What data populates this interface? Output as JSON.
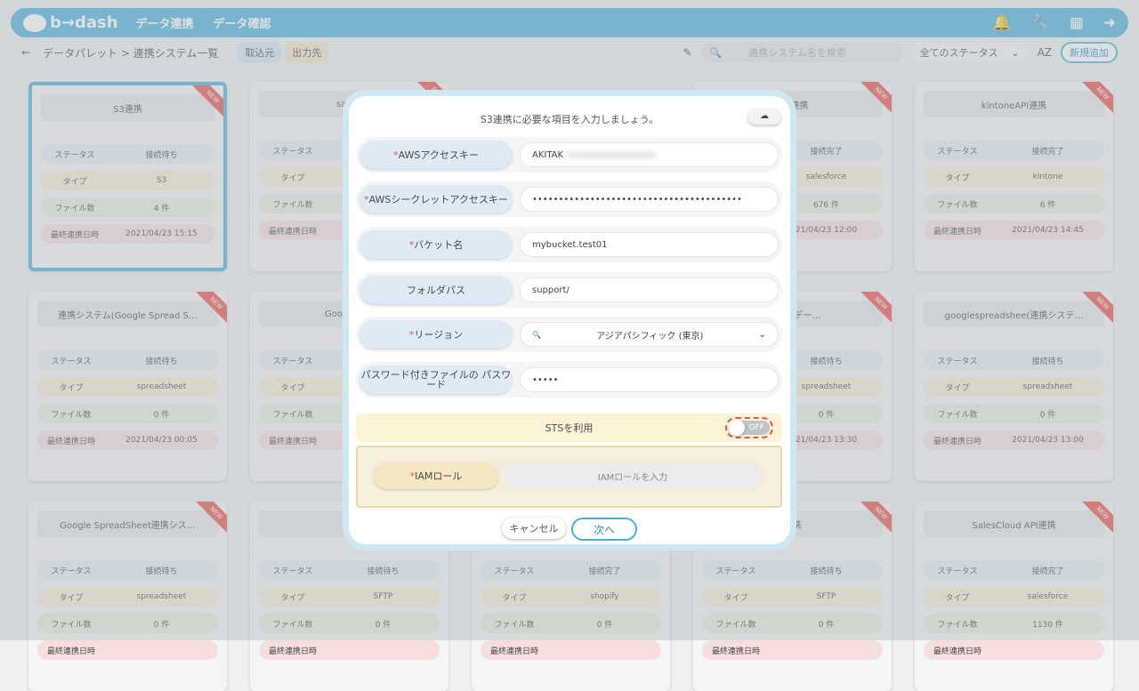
{
  "header": {
    "logo": "b→dash",
    "nav": [
      "データ連携",
      "データ確認"
    ]
  },
  "subbar": {
    "back": "←",
    "breadcrumb": "データパレット > 連携システム一覧",
    "tab_source": "取込元",
    "tab_dest": "出力先",
    "search_placeholder": "連携システム名を検索",
    "status_filter": "全てのステータス",
    "sort": "AZ",
    "add_button": "新規追加"
  },
  "labels": {
    "status": "ステータス",
    "type": "タイプ",
    "files": "ファイル数",
    "last": "最終連携日時",
    "ribbon": "NEW"
  },
  "cards": [
    {
      "title": "S3連携",
      "status": "接続待ち",
      "type": "S3",
      "files": "4 件",
      "last": "2021/04/23 15:15"
    },
    {
      "title": "sansa",
      "status": "",
      "type": "",
      "files": "",
      "last": ""
    },
    {
      "title": "API連携",
      "status": "接続完了",
      "type": "salesforce",
      "files": "676 件",
      "last": "21/04/23 12:00"
    },
    {
      "title": "kintoneAPI連携",
      "status": "接続完了",
      "type": "kintone",
      "files": "6 件",
      "last": "2021/04/23 14:45"
    },
    {
      "title": "連携システム(Google Spread S…",
      "status": "接続待ち",
      "type": "spreadsheet",
      "files": "0 件",
      "last": "2021/04/23 00:05"
    },
    {
      "title": "Google Spr",
      "status": "",
      "type": "",
      "files": "",
      "last": ""
    },
    {
      "title": "et(顧客デー…",
      "status": "接続待ち",
      "type": "spreadsheet",
      "files": "0 件",
      "last": "21/04/23 13:30"
    },
    {
      "title": "googlespreadshee(連携システ…",
      "status": "接続待ち",
      "type": "spreadsheet",
      "files": "0 件",
      "last": "2021/04/23 13:00"
    },
    {
      "title": "Google SpreadSheet連携シス…",
      "status": "接続待ち",
      "type": "spreadsheet",
      "files": "0 件",
      "last": ""
    },
    {
      "title": "SF",
      "status": "接続待ち",
      "type": "SFTP",
      "files": "0 件",
      "last": ""
    },
    {
      "title": "",
      "status": "接続完了",
      "type": "shopify",
      "files": "0 件",
      "last": ""
    },
    {
      "title": "連携",
      "status": "接続待ち",
      "type": "SFTP",
      "files": "0 件",
      "last": ""
    },
    {
      "title": "SalesCloud API連携",
      "status": "接続完了",
      "type": "salesforce",
      "files": "1130 件",
      "last": ""
    }
  ],
  "modal": {
    "heading": "S3連携に必要な項目を入力しましょう。",
    "fields": [
      {
        "label": "AWSアクセスキー",
        "required": "*",
        "value": "AKITAK"
      },
      {
        "label": "AWSシークレットアクセスキー",
        "required": "*",
        "value": "••••••••••••••••••••••••••••••••••••••••"
      },
      {
        "label": "バケット名",
        "required": "*",
        "value": "mybucket.test01"
      },
      {
        "label": "フォルダパス",
        "required": "",
        "value": "support/"
      },
      {
        "label": "リージョン",
        "required": "*",
        "value": "アジアパシフィック (東京)"
      },
      {
        "label": "パスワード付きファイルの パスワード",
        "required": "",
        "value": "•••••"
      }
    ],
    "sts_label": "STSを利用",
    "sts_toggle": "OFF",
    "iam_label": "IAMロール",
    "iam_required": "*",
    "iam_placeholder": "IAMロールを入力",
    "cancel": "キャンセル",
    "next": "次へ"
  }
}
